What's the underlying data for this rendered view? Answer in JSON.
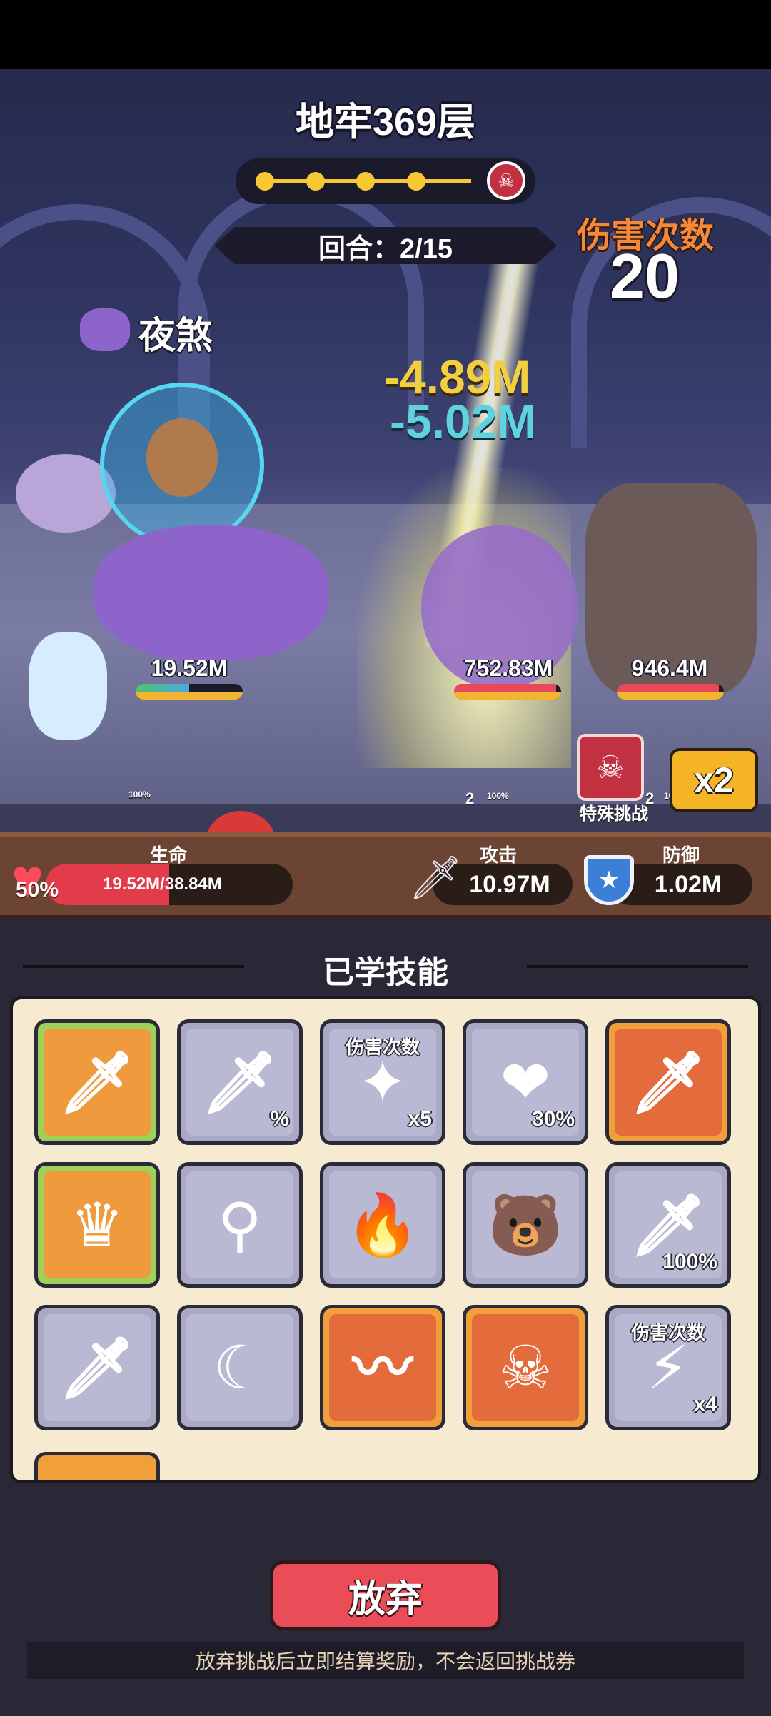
{
  "dungeon": {
    "title": "地牢369层",
    "round": "回合：2/15"
  },
  "hit_counter": {
    "label": "伤害次数",
    "value": "20"
  },
  "damage_numbers": [
    "-4.89M",
    "-5.02M"
  ],
  "player": {
    "mount_name": "夜煞",
    "hp": "19.52M",
    "hp_fraction": 0.5
  },
  "enemies": [
    {
      "hp": "752.83M",
      "buff_count": "2",
      "hp_fraction": 0.95
    },
    {
      "hp": "946.4M",
      "buff_count": "2",
      "hp_fraction": 0.95
    }
  ],
  "status_tags": [
    "100%",
    "100%",
    "100%"
  ],
  "special_challenge": {
    "label": "特殊挑战",
    "icon": "skull-icon"
  },
  "speed": {
    "label": "x2"
  },
  "stats": {
    "life_label": "生命",
    "life_value": "19.52M/38.84M",
    "life_percent": "50%",
    "attack_label": "攻击",
    "attack_value": "10.97M",
    "defense_label": "防御",
    "defense_value": "1.02M"
  },
  "skills_title": "已学技能",
  "skills": [
    {
      "icon": "sword-wave-icon",
      "style": "green",
      "glyph": "🗡"
    },
    {
      "icon": "crit-sword-icon",
      "style": "gray",
      "glyph": "🗡",
      "text": "%"
    },
    {
      "icon": "hit-count-burst-icon",
      "style": "gray",
      "glyph": "✦",
      "top": "伤害次数",
      "text": "x5"
    },
    {
      "icon": "heart-heal-icon",
      "style": "gray",
      "glyph": "❤",
      "text": "30%"
    },
    {
      "icon": "dash-sword-icon",
      "style": "orange",
      "glyph": "🗡"
    },
    {
      "icon": "crown-icon",
      "style": "green",
      "glyph": "♛"
    },
    {
      "icon": "golden-staff-icon",
      "style": "gray",
      "glyph": "⚲"
    },
    {
      "icon": "fire-sword-icon",
      "style": "gray",
      "glyph": "🔥"
    },
    {
      "icon": "capybara-icon",
      "style": "gray",
      "glyph": "🐻"
    },
    {
      "icon": "break-sword-icon",
      "style": "gray",
      "glyph": "🗡",
      "text": "100%"
    },
    {
      "icon": "dark-sword-icon",
      "style": "gray",
      "glyph": "🗡"
    },
    {
      "icon": "crescent-fire-icon",
      "style": "gray",
      "glyph": "☾"
    },
    {
      "icon": "water-wave-icon",
      "style": "orange",
      "glyph": "〰"
    },
    {
      "icon": "skull-ice-icon",
      "style": "orange",
      "glyph": "☠"
    },
    {
      "icon": "lightning-hit-icon",
      "style": "gray",
      "glyph": "⚡",
      "top": "伤害次数",
      "text": "x4"
    }
  ],
  "give_up": {
    "label": "放弃",
    "notice": "放弃挑战后立即结算奖励，不会返回挑战券"
  }
}
